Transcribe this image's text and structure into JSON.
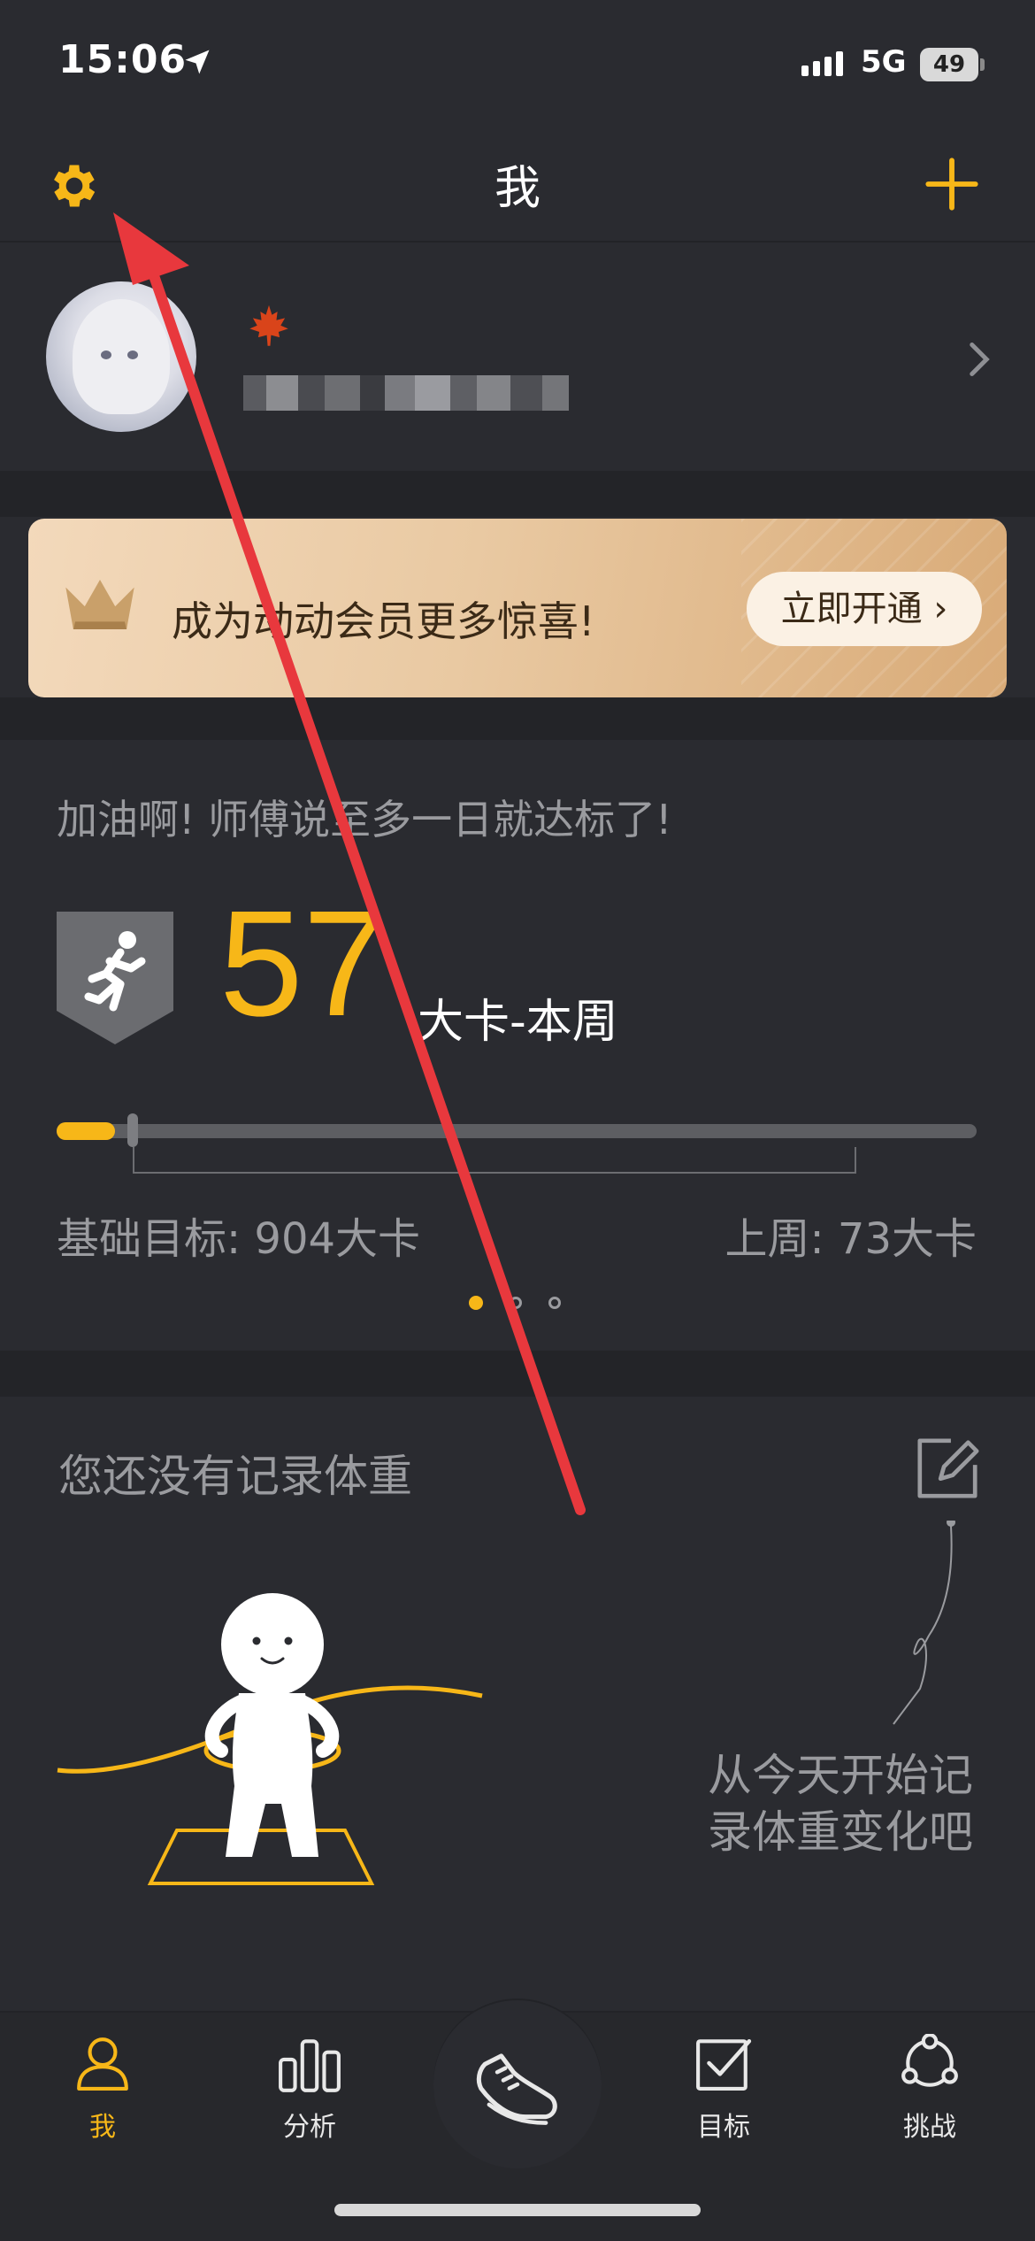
{
  "status_bar": {
    "time": "15:06",
    "network": "5G",
    "battery": "49"
  },
  "nav": {
    "title": "我"
  },
  "profile": {
    "leaf_icon": "maple-leaf-icon"
  },
  "vip_banner": {
    "text": "成为动动会员更多惊喜!",
    "button": "立即开通 ›"
  },
  "calories": {
    "encouragement": "加油啊! 师傅说至多一日就达标了!",
    "value": "57",
    "unit": "大卡-本周",
    "progress_fraction": 0.063,
    "base_goal": "基础目标: 904大卡",
    "last_week": "上周: 73大卡",
    "page_count": 3,
    "active_page": 0
  },
  "weight": {
    "title": "您还没有记录体重",
    "hint": "从今天开始记录体重变化吧"
  },
  "tabs": [
    {
      "id": "me",
      "label": "我",
      "icon": "person-icon",
      "active": true
    },
    {
      "id": "analysis",
      "label": "分析",
      "icon": "bar-chart-icon",
      "active": false
    },
    {
      "id": "run",
      "label": "",
      "icon": "running-shoe-icon",
      "active": false
    },
    {
      "id": "goal",
      "label": "目标",
      "icon": "checkbox-icon",
      "active": false
    },
    {
      "id": "challenge",
      "label": "挑战",
      "icon": "group-icon",
      "active": false
    }
  ],
  "colors": {
    "accent": "#f7b718",
    "background": "#2a2b30",
    "annotation": "#e8383d"
  }
}
